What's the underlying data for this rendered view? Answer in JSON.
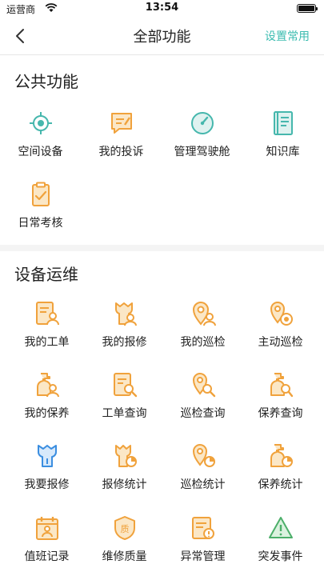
{
  "status_bar": {
    "carrier": "运营商",
    "time": "13:54"
  },
  "navbar": {
    "title": "全部功能",
    "action_label": "设置常用"
  },
  "sections": [
    {
      "title": "公共功能",
      "items": [
        {
          "label": "空间设备",
          "icon": "location-target-icon"
        },
        {
          "label": "我的投诉",
          "icon": "complaint-icon"
        },
        {
          "label": "管理驾驶舱",
          "icon": "dashboard-gauge-icon"
        },
        {
          "label": "知识库",
          "icon": "book-icon"
        },
        {
          "label": "日常考核",
          "icon": "clipboard-check-icon"
        }
      ]
    },
    {
      "title": "设备运维",
      "items": [
        {
          "label": "我的工单",
          "icon": "work-order-icon"
        },
        {
          "label": "我的报修",
          "icon": "repair-wrench-icon"
        },
        {
          "label": "我的巡检",
          "icon": "inspection-pin-icon"
        },
        {
          "label": "主动巡检",
          "icon": "active-inspection-icon"
        },
        {
          "label": "我的保养",
          "icon": "maintenance-bottle-icon"
        },
        {
          "label": "工单查询",
          "icon": "order-search-icon"
        },
        {
          "label": "巡检查询",
          "icon": "inspection-search-icon"
        },
        {
          "label": "保养查询",
          "icon": "maintenance-search-icon"
        },
        {
          "label": "我要报修",
          "icon": "wrench-icon"
        },
        {
          "label": "报修统计",
          "icon": "repair-stats-icon"
        },
        {
          "label": "巡检统计",
          "icon": "inspection-stats-icon"
        },
        {
          "label": "保养统计",
          "icon": "maintenance-stats-icon"
        },
        {
          "label": "值班记录",
          "icon": "duty-record-icon"
        },
        {
          "label": "维修质量",
          "icon": "quality-badge-icon"
        },
        {
          "label": "异常管理",
          "icon": "exception-icon"
        },
        {
          "label": "突发事件",
          "icon": "warning-triangle-icon"
        }
      ]
    }
  ]
}
